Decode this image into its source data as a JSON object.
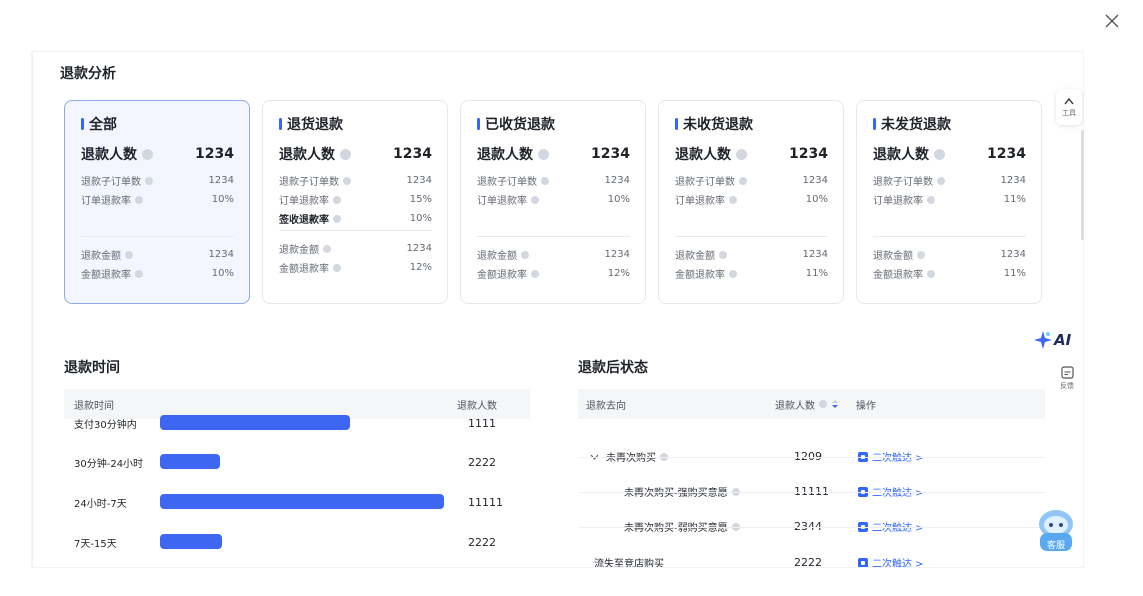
{
  "section_refund_analysis": "退款分析",
  "cards": [
    {
      "title": "全部",
      "main_label": "退款人数",
      "main_value": "1234",
      "r1_label": "退款子订单数",
      "r1_value": "1234",
      "r2_label": "订单退款率",
      "r2_value": "10%",
      "r4_label": "退款金额",
      "r4_value": "1234",
      "r5_label": "金额退款率",
      "r5_value": "10%"
    },
    {
      "title": "退货退款",
      "main_label": "退款人数",
      "main_value": "1234",
      "r1_label": "退款子订单数",
      "r1_value": "1234",
      "r2_label": "订单退款率",
      "r2_value": "15%",
      "r3_label": "签收退款率",
      "r3_value": "10%",
      "r4_label": "退款金额",
      "r4_value": "1234",
      "r5_label": "金额退款率",
      "r5_value": "12%"
    },
    {
      "title": "已收货退款",
      "main_label": "退款人数",
      "main_value": "1234",
      "r1_label": "退款子订单数",
      "r1_value": "1234",
      "r2_label": "订单退款率",
      "r2_value": "10%",
      "r4_label": "退款金额",
      "r4_value": "1234",
      "r5_label": "金额退款率",
      "r5_value": "12%"
    },
    {
      "title": "未收货退款",
      "main_label": "退款人数",
      "main_value": "1234",
      "r1_label": "退款子订单数",
      "r1_value": "1234",
      "r2_label": "订单退款率",
      "r2_value": "10%",
      "r4_label": "退款金额",
      "r4_value": "1234",
      "r5_label": "金额退款率",
      "r5_value": "11%"
    },
    {
      "title": "未发货退款",
      "main_label": "退款人数",
      "main_value": "1234",
      "r1_label": "退款子订单数",
      "r1_value": "1234",
      "r2_label": "订单退款率",
      "r2_value": "11%",
      "r4_label": "退款金额",
      "r4_value": "1234",
      "r5_label": "金额退款率",
      "r5_value": "11%"
    }
  ],
  "refund_time": {
    "title": "退款时间",
    "col1": "退款时间",
    "col2": "退款人数",
    "rows": [
      {
        "label": "支付30分钟内",
        "value": "1111",
        "fraction": 0.67
      },
      {
        "label": "30分钟-24小时",
        "value": "2222",
        "fraction": 0.21
      },
      {
        "label": "24小时-7天",
        "value": "11111",
        "fraction": 1.0
      },
      {
        "label": "7天-15天",
        "value": "2222",
        "fraction": 0.22
      }
    ]
  },
  "after_status": {
    "title": "退款后状态",
    "col1": "退款去向",
    "col2": "退款人数",
    "col3": "操作",
    "rows": [
      {
        "label": "未再次购买",
        "value": "1209",
        "action": "二次触达 >"
      },
      {
        "label": "未再次购买-强购买意愿",
        "value": "11111",
        "action": "二次触达 >"
      },
      {
        "label": "未再次购买-弱购买意愿",
        "value": "2344",
        "action": "二次触达 >"
      },
      {
        "label": "流失至竞店购买",
        "value": "2222",
        "action": "二次触达 >"
      }
    ]
  },
  "side_tools": {
    "tool_label": "工具",
    "ai_label": "AI",
    "feedback_label": "反馈",
    "service_label": "客服"
  },
  "colors": {
    "accent": "#3366ff",
    "bar": "#3d66f2",
    "active_card_bg": "#f3f6fe"
  }
}
